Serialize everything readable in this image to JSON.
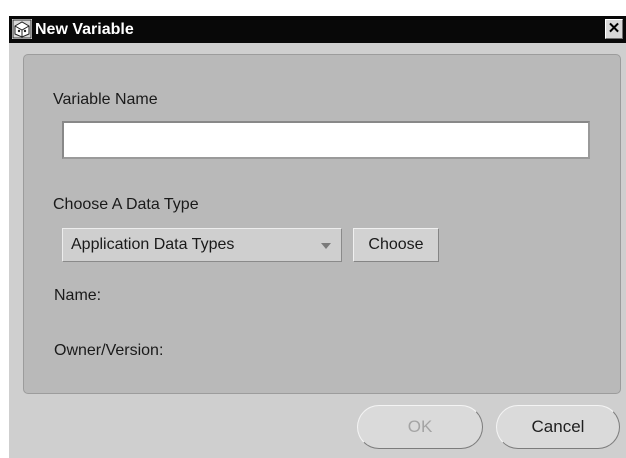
{
  "window": {
    "title": "New Variable",
    "close_glyph": "✕",
    "app_icon": "app-icon",
    "close_icon": "close-icon"
  },
  "form": {
    "variable_name_label": "Variable Name",
    "variable_name_value": "",
    "data_type_label": "Choose A Data Type",
    "data_type_selected": "Application Data Types",
    "choose_button": "Choose",
    "name_label": "Name:",
    "owner_version_label": "Owner/Version:"
  },
  "footer": {
    "ok_button": "OK",
    "ok_enabled": false,
    "cancel_button": "Cancel"
  },
  "colors": {
    "titlebar": "#080808",
    "window_bg": "#cfcfcf",
    "panel_bg": "#b9b9b9",
    "disabled_text": "#a4a4a4"
  }
}
